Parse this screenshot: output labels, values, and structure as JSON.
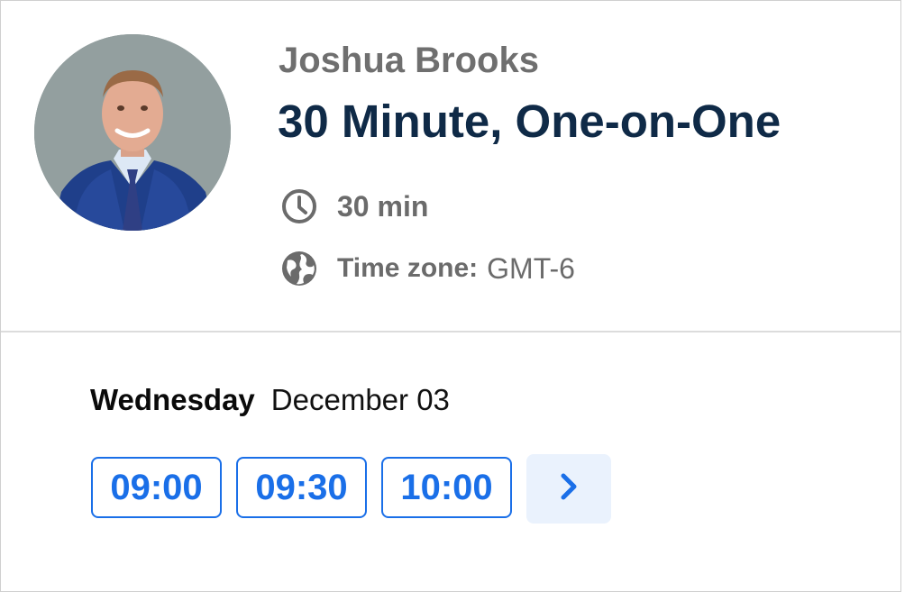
{
  "host": {
    "name": "Joshua Brooks"
  },
  "event": {
    "title": "30 Minute, One-on-One",
    "duration": "30 min",
    "timezone_label": "Time zone:",
    "timezone_value": "GMT-6"
  },
  "schedule": {
    "weekday": "Wednesday",
    "date": "December 03",
    "slots": [
      "09:00",
      "09:30",
      "10:00"
    ]
  },
  "icons": {
    "duration": "clock-icon",
    "timezone": "globe-icon",
    "next": "chevron-right-icon"
  },
  "colors": {
    "title": "#0f2a47",
    "muted_text": "#6b6b6b",
    "accent": "#1a6fe8",
    "next_button_bg": "#eaf2fd"
  }
}
